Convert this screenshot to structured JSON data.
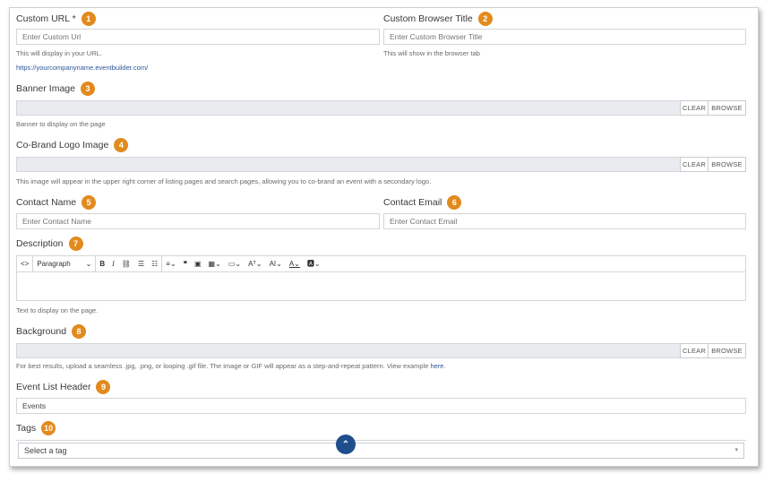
{
  "fields": {
    "custom_url": {
      "label": "Custom URL *",
      "badge": "1",
      "placeholder": "Enter Custom Url",
      "help": "This will display in your URL.",
      "link": "https://yourcompanyname.eventbuilder.com/"
    },
    "custom_browser_title": {
      "label": "Custom Browser Title",
      "badge": "2",
      "placeholder": "Enter Custom Browser Title",
      "help": "This will show in the browser tab"
    },
    "banner_image": {
      "label": "Banner Image",
      "badge": "3",
      "help": "Banner to display on the page"
    },
    "cobrand_logo": {
      "label": "Co-Brand Logo Image",
      "badge": "4",
      "help": "This image will appear in the upper right corner of listing pages and search pages, allowing you to co-brand an event with a secondary logo."
    },
    "contact_name": {
      "label": "Contact Name",
      "badge": "5",
      "placeholder": "Enter Contact Name"
    },
    "contact_email": {
      "label": "Contact Email",
      "badge": "6",
      "placeholder": "Enter Contact Email"
    },
    "description": {
      "label": "Description",
      "badge": "7",
      "help": "Text to display on the page.",
      "format_select": "Paragraph"
    },
    "background": {
      "label": "Background",
      "badge": "8",
      "help_prefix": "For best results, upload a seamless .jpg, .png, or looping .gif file. The image or GIF will appear as a step-and-repeat pattern. View example ",
      "help_link": "here",
      "help_suffix": "."
    },
    "event_list_header": {
      "label": "Event List Header",
      "badge": "9",
      "value": "Events"
    },
    "tags": {
      "label": "Tags",
      "badge": "10",
      "placeholder": "Select a tag"
    }
  },
  "file_buttons": {
    "clear": "CLEAR",
    "browse": "BROWSE"
  },
  "toolbar_icons": [
    "code-icon",
    "bold-icon",
    "italic-icon",
    "link-icon",
    "bullet-list-icon",
    "numbered-list-icon",
    "align-icon",
    "quote-icon",
    "image-icon",
    "table-icon",
    "media-icon",
    "font-size-icon",
    "text-size-icon",
    "font-color-icon",
    "highlight-icon"
  ],
  "colors": {
    "badge": "#e28a1e",
    "link": "#2a5699",
    "scroll_button": "#1f4e8c"
  }
}
